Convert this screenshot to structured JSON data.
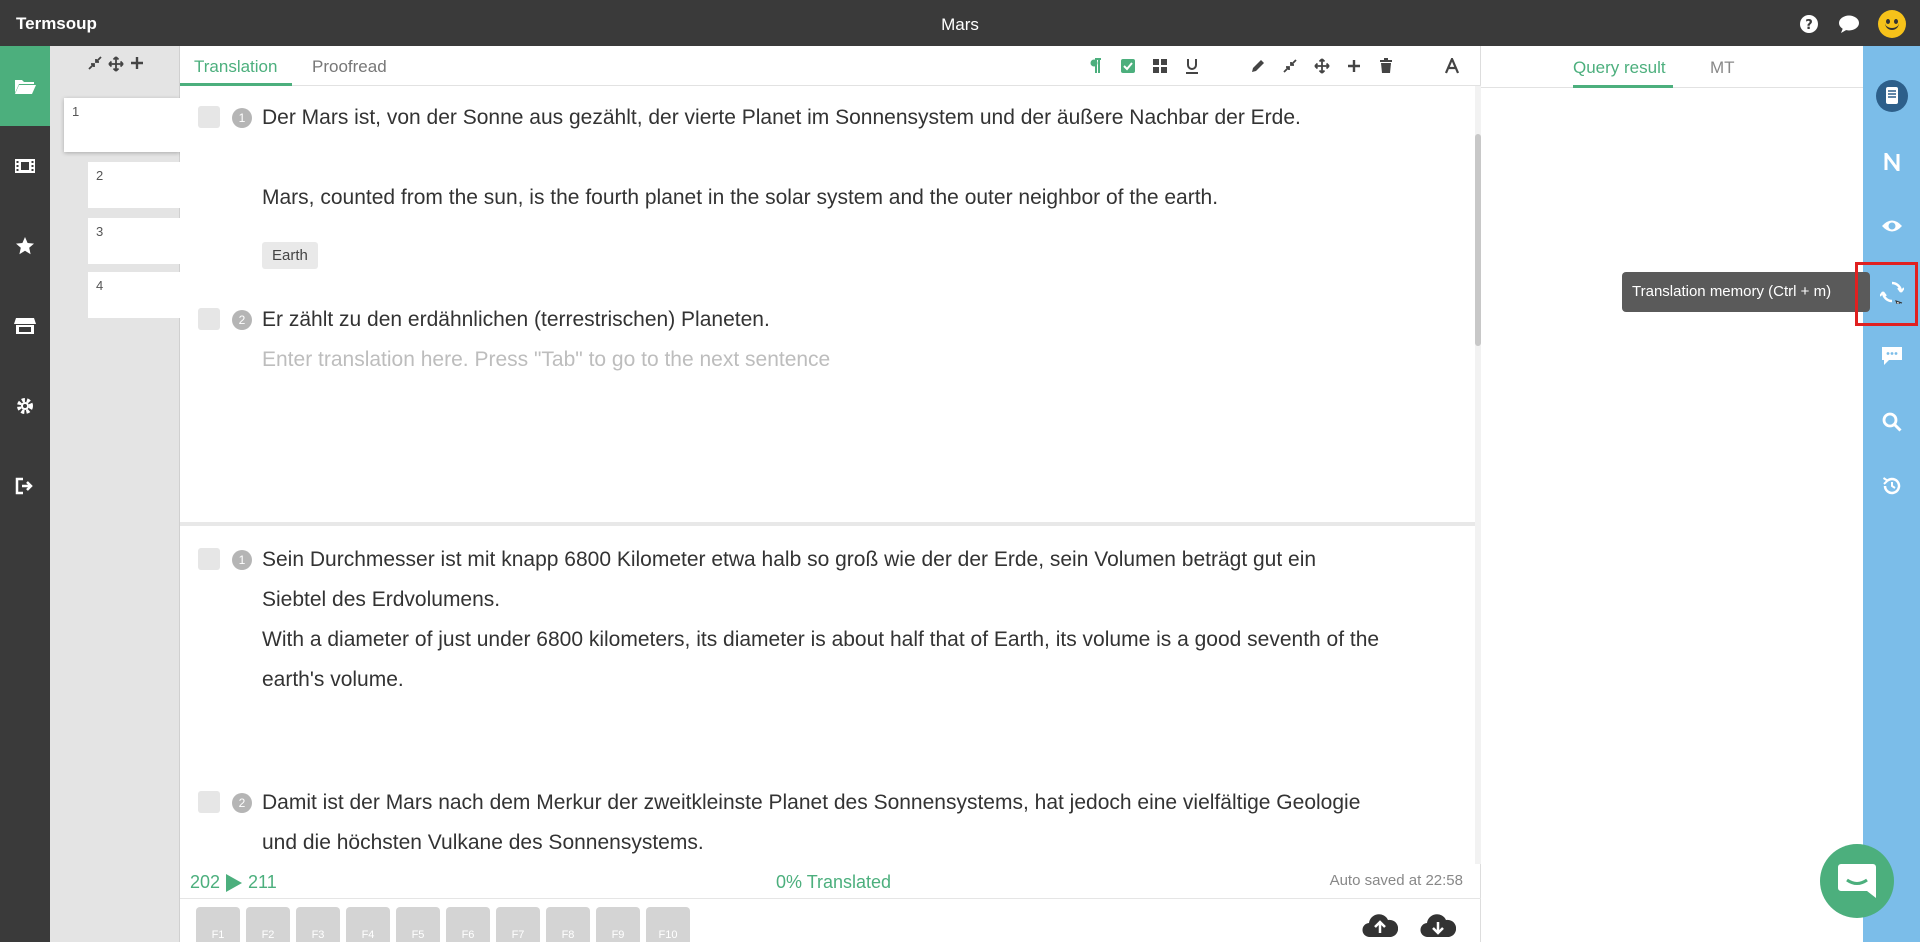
{
  "titlebar": {
    "app_name": "Termsoup",
    "document_title": "Mars",
    "icons": [
      "help-icon",
      "chat-icon",
      "smiley-avatar-icon"
    ]
  },
  "leftbar": {
    "items": [
      {
        "icon": "folder-open-icon",
        "active": true
      },
      {
        "icon": "film-icon",
        "active": false
      },
      {
        "icon": "star-icon",
        "active": false
      },
      {
        "icon": "store-icon",
        "active": false
      },
      {
        "icon": "gear-icon",
        "active": false
      },
      {
        "icon": "sign-out-icon",
        "active": false
      }
    ]
  },
  "thumbnails": {
    "tools": [
      "compress-icon",
      "move-icon",
      "plus-icon"
    ],
    "pages": [
      "1",
      "2",
      "3",
      "4"
    ]
  },
  "editor": {
    "tabs": [
      "Translation",
      "Proofread"
    ],
    "active_tab": "Translation",
    "toolbar_icons": [
      "pilcrow-icon",
      "check-square-icon",
      "grid-icon",
      "underline-icon",
      "pencil-icon",
      "compress-icon",
      "move-icon",
      "plus-icon",
      "trash-icon",
      "font-icon"
    ],
    "segments": [
      {
        "num": "1",
        "source": "Der Mars ist, von der Sonne aus gezählt, der vierte Planet im Sonnensystem und der äußere Nachbar der Erde.",
        "target": "Mars, counted from the sun, is the fourth planet in the solar system and the outer neighbor of the earth.",
        "term": "Earth"
      },
      {
        "num": "2",
        "source": "Er zählt zu den erdähnlichen (terrestrischen) Planeten.",
        "target_placeholder": "Enter translation here. Press \"Tab\" to go to the next sentence"
      },
      {
        "num": "1",
        "source": "Sein Durchmesser ist mit knapp 6800 Kilometer etwa halb so groß wie der der Erde, sein Volumen beträgt gut ein Siebtel des Erdvolumens.",
        "target": "With a diameter of just under 6800 kilometers, its diameter is about half that of Earth, its volume is a good seventh of the earth's volume."
      },
      {
        "num": "2",
        "source": "Damit ist der Mars nach dem Merkur der zweitkleinste Planet des Sonnensystems, hat jedoch eine vielfältige Geologie und die höchsten Vulkane des Sonnensystems."
      }
    ],
    "status": {
      "current": "202",
      "total": "211",
      "translated": "0% Translated",
      "autosave": "Auto saved at 22:58"
    },
    "fkeys": [
      "F1",
      "F2",
      "F3",
      "F4",
      "F5",
      "F6",
      "F7",
      "F8",
      "F9",
      "F10"
    ],
    "io_icons": [
      "cloud-upload-icon",
      "cloud-download-icon"
    ]
  },
  "rightpanel": {
    "tabs": [
      "Query result",
      "MT"
    ],
    "active_tab": "Query result"
  },
  "bluebar": {
    "items": [
      "notebook-icon",
      "n-letter-icon",
      "eye-icon",
      "translation-memory-icon",
      "comment-icon",
      "search-icon",
      "history-icon"
    ],
    "tooltip": "Translation memory (Ctrl + m)"
  },
  "colors": {
    "accent": "#4caf7d",
    "dark": "#3a3a3a",
    "blue_bar": "#7bbde9",
    "highlight": "#e02020"
  }
}
